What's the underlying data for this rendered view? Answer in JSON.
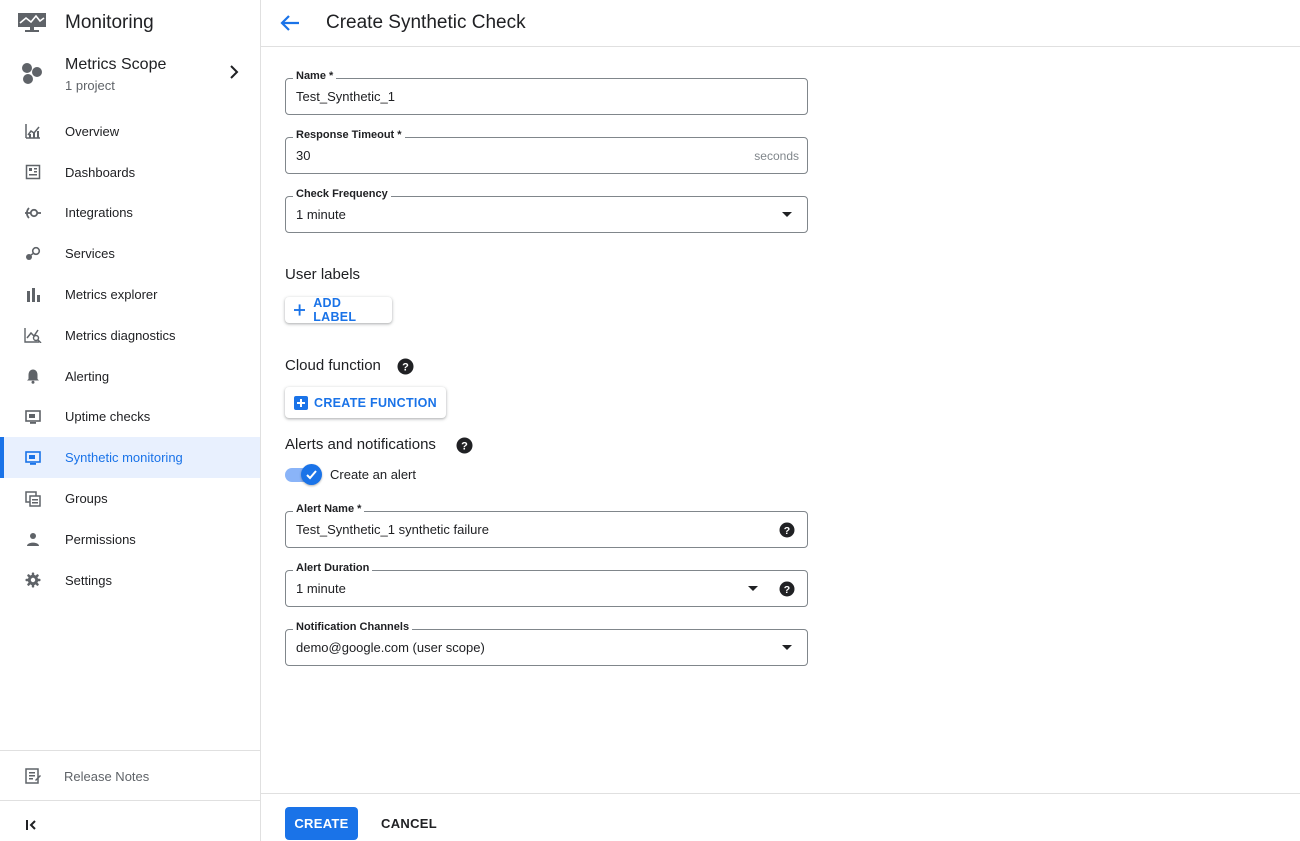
{
  "app": {
    "title": "Monitoring"
  },
  "scope": {
    "title": "Metrics Scope",
    "subtitle": "1 project"
  },
  "nav": {
    "items": [
      {
        "label": "Overview",
        "icon": "overview-icon"
      },
      {
        "label": "Dashboards",
        "icon": "dashboards-icon"
      },
      {
        "label": "Integrations",
        "icon": "integrations-icon"
      },
      {
        "label": "Services",
        "icon": "services-icon"
      },
      {
        "label": "Metrics explorer",
        "icon": "bar-chart-icon"
      },
      {
        "label": "Metrics diagnostics",
        "icon": "diagnostics-icon"
      },
      {
        "label": "Alerting",
        "icon": "bell-icon"
      },
      {
        "label": "Uptime checks",
        "icon": "monitor-icon"
      },
      {
        "label": "Synthetic monitoring",
        "icon": "monitor-icon",
        "active": true
      },
      {
        "label": "Groups",
        "icon": "groups-icon"
      },
      {
        "label": "Permissions",
        "icon": "person-icon"
      },
      {
        "label": "Settings",
        "icon": "gear-icon"
      }
    ],
    "release_notes": "Release Notes"
  },
  "header": {
    "title": "Create Synthetic Check"
  },
  "form": {
    "name": {
      "label": "Name *",
      "value": "Test_Synthetic_1"
    },
    "timeout": {
      "label": "Response Timeout *",
      "value": "30",
      "suffix": "seconds"
    },
    "frequency": {
      "label": "Check Frequency",
      "value": "1 minute"
    },
    "user_labels": {
      "title": "User labels",
      "button": "ADD LABEL"
    },
    "cloud_function": {
      "title": "Cloud function",
      "button": "CREATE FUNCTION"
    },
    "alerts": {
      "title": "Alerts and notifications",
      "toggle_label": "Create an alert",
      "toggle_on": true,
      "alert_name": {
        "label": "Alert Name *",
        "value": "Test_Synthetic_1 synthetic failure"
      },
      "alert_duration": {
        "label": "Alert Duration",
        "value": "1 minute"
      },
      "channels": {
        "label": "Notification Channels",
        "value": "demo@google.com (user scope)"
      }
    }
  },
  "footer": {
    "create": "CREATE",
    "cancel": "CANCEL"
  },
  "colors": {
    "accent": "#1a73e8",
    "active_bg": "#e8f0fe",
    "toggle_track": "#8ab4f8"
  }
}
